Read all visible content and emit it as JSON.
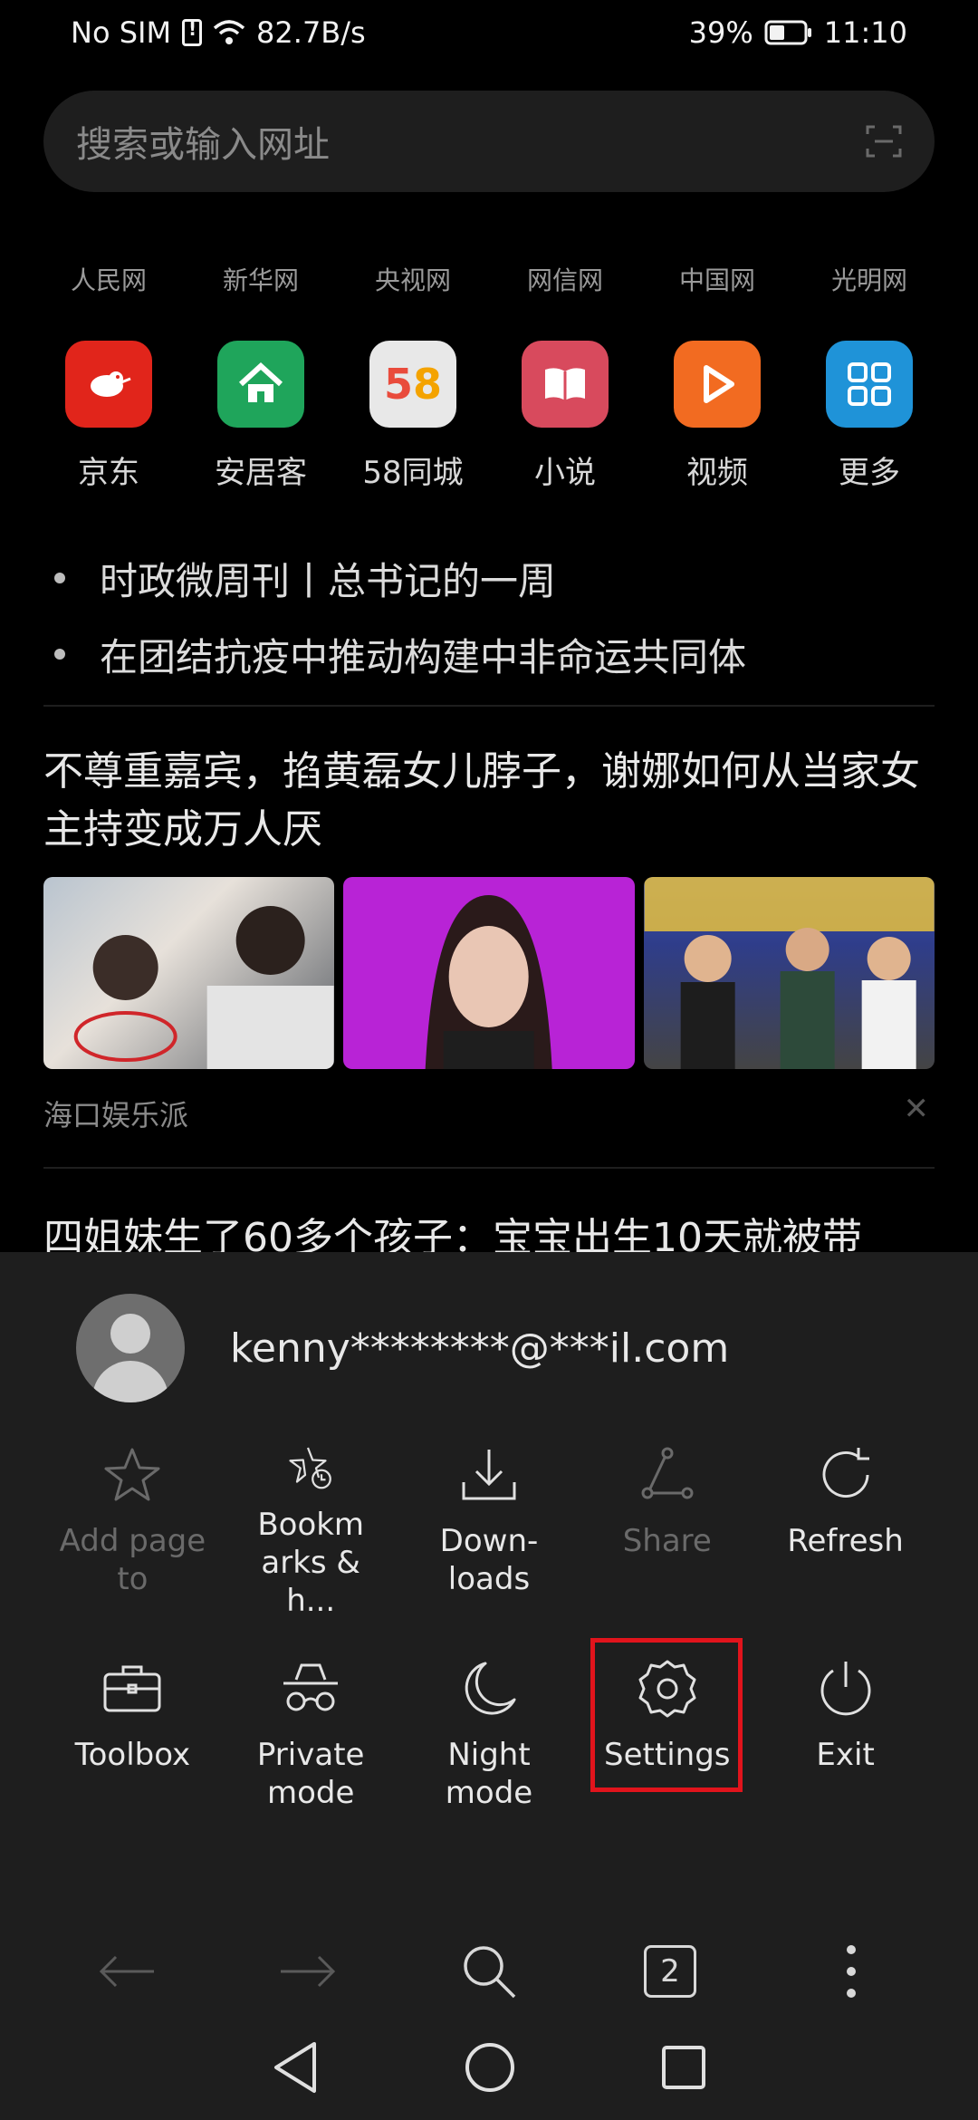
{
  "status": {
    "carrier": "No SIM",
    "speed": "82.7B/s",
    "battery": "39%",
    "time": "11:10"
  },
  "search": {
    "placeholder": "搜索或输入网址"
  },
  "news_links": [
    "人民网",
    "新华网",
    "央视网",
    "网信网",
    "中国网",
    "光明网"
  ],
  "apps": [
    {
      "label": "京东",
      "icon": "jd-icon",
      "color": "#e1251b"
    },
    {
      "label": "安居客",
      "icon": "anjuke-icon",
      "color": "#1fa55b"
    },
    {
      "label": "58同城",
      "icon": "58-icon",
      "color": "#e8e8e8"
    },
    {
      "label": "小说",
      "icon": "novel-icon",
      "color": "#d84a5d"
    },
    {
      "label": "视频",
      "icon": "video-icon",
      "color": "#f26b21"
    },
    {
      "label": "更多",
      "icon": "more-icon",
      "color": "#1f93d8"
    }
  ],
  "headlines": [
    "时政微周刊丨总书记的一周",
    "在团结抗疫中推动构建中非命运共同体"
  ],
  "article": {
    "title": "不尊重嘉宾，掐黄磊女儿脖子，谢娜如何从当家女主持变成万人厌",
    "source": "海口娱乐派",
    "close": "✕"
  },
  "article2": {
    "title": "四姐妹生了60多个孩子：宝宝出生10天就被带"
  },
  "account": {
    "email": "kenny********@***il.com"
  },
  "menu": [
    {
      "label": "Add page to",
      "icon": "star-icon",
      "disabled": true
    },
    {
      "label": "Bookm arks & h...",
      "icon": "bookmark-history-icon",
      "disabled": false
    },
    {
      "label": "Down- loads",
      "icon": "download-icon",
      "disabled": false
    },
    {
      "label": "Share",
      "icon": "share-icon",
      "disabled": true
    },
    {
      "label": "Refresh",
      "icon": "refresh-icon",
      "disabled": false
    },
    {
      "label": "Toolbox",
      "icon": "toolbox-icon",
      "disabled": false
    },
    {
      "label": "Private mode",
      "icon": "incognito-icon",
      "disabled": false
    },
    {
      "label": "Night mode",
      "icon": "moon-icon",
      "disabled": false
    },
    {
      "label": "Settings",
      "icon": "gear-icon",
      "disabled": false,
      "highlighted": true
    },
    {
      "label": "Exit",
      "icon": "power-icon",
      "disabled": false
    }
  ],
  "toolbar": {
    "tab_count": "2"
  },
  "colors": {
    "highlight": "#e1141c",
    "sheet_bg": "#1e1e1e"
  }
}
